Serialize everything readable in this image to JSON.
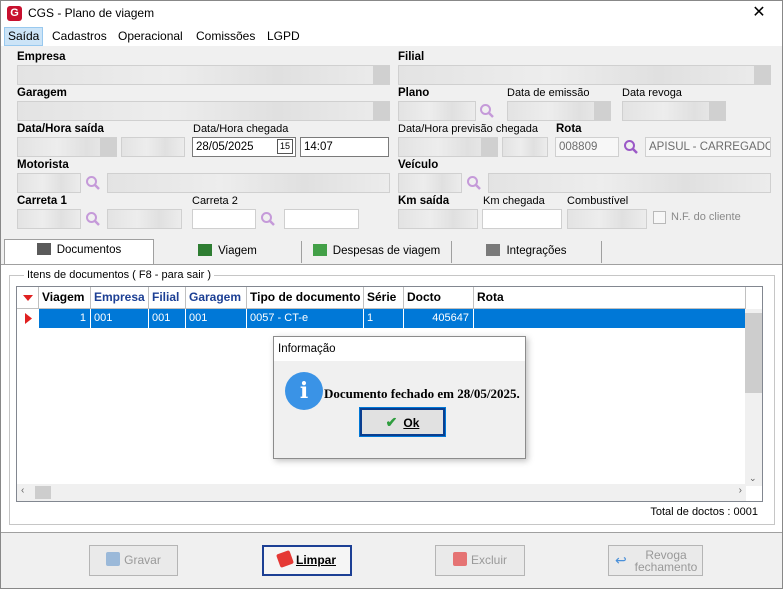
{
  "window": {
    "title": "CGS - Plano de viagem",
    "close_glyph": "✕"
  },
  "menu": [
    "Saída",
    "Cadastros",
    "Operacional",
    "Comissões",
    "LGPD"
  ],
  "form": {
    "empresa_label": "Empresa",
    "filial_label": "Filial",
    "garagem_label": "Garagem",
    "plano_label": "Plano",
    "data_emissao_label": "Data de emissão",
    "data_revoga_label": "Data revoga",
    "data_hora_saida_label": "Data/Hora saída",
    "data_hora_chegada_label": "Data/Hora chegada",
    "data_chegada_value": "28/05/2025",
    "hora_chegada_value": "14:07",
    "data_hora_previsao_label": "Data/Hora previsão chegada",
    "rota_label": "Rota",
    "rota_code": "008809",
    "rota_name": "APISUL - CARREGADO -",
    "motorista_label": "Motorista",
    "veiculo_label": "Veículo",
    "carreta1_label": "Carreta 1",
    "carreta2_label": "Carreta 2",
    "km_saida_label": "Km saída",
    "km_chegada_label": "Km chegada",
    "combustivel_label": "Combustível",
    "nf_cliente_label": "N.F. do cliente"
  },
  "tabs": [
    "Documentos",
    "Viagem",
    "Despesas de viagem",
    "Integrações"
  ],
  "grid": {
    "group_label": "Itens de documentos ( F8 - para sair )",
    "columns": [
      "Viagem",
      "Empresa",
      "Filial",
      "Garagem",
      "Tipo de documento",
      "Série",
      "Docto",
      "Rota"
    ],
    "rows": [
      {
        "viagem": "1",
        "empresa": "001",
        "filial": "001",
        "garagem": "001",
        "tipo": "0057 - CT-e",
        "serie": "1",
        "docto": "405647",
        "rota": ""
      }
    ],
    "total_label": "Total de doctos : 0001"
  },
  "dialog": {
    "title": "Informação",
    "message": "Documento fechado em 28/05/2025.",
    "ok_label": "Ok"
  },
  "buttons": {
    "gravar": "Gravar",
    "limpar": "Limpar",
    "excluir": "Excluir",
    "revoga_line1": "Revoga",
    "revoga_line2": "fechamento"
  },
  "colors": {
    "accent": "#0078d7",
    "header_blue": "#1c3f94",
    "info_blue": "#3a93e6"
  }
}
